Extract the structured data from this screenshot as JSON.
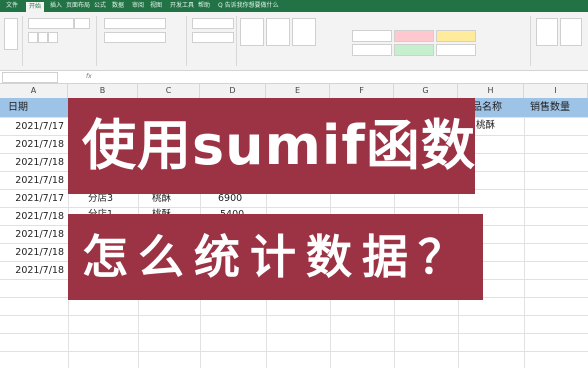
{
  "ribbon": {
    "tabs": [
      "文件",
      "开始",
      "插入",
      "页面布局",
      "公式",
      "数据",
      "审阅",
      "视图",
      "开发工具",
      "帮助",
      "Q 告诉我你想要做什么"
    ],
    "active_tab": "开始"
  },
  "columns": [
    "A",
    "B",
    "C",
    "D",
    "E",
    "F",
    "G",
    "H",
    "I"
  ],
  "sheet": {
    "header_a": "日期",
    "header_h": "品名称",
    "header_i": "销售数量",
    "h2": "桃酥",
    "dates": [
      "2021/7/17",
      "2021/7/18",
      "2021/7/18",
      "2021/7/18",
      "2021/7/17",
      "2021/7/18",
      "2021/7/18",
      "2021/7/18",
      "2021/7/18"
    ],
    "partial_rows": [
      {
        "b": "分店3",
        "c": "桃酥",
        "d": "6900"
      },
      {
        "b": "分店1",
        "c": "桃酥",
        "d": "5400"
      }
    ]
  },
  "overlay": {
    "line1": "使用sumif函数",
    "line2": "怎么统计数据？"
  },
  "colors": {
    "excel_green": "#217346",
    "header_fill": "#9dc3e6",
    "banner": "#9c3344"
  }
}
